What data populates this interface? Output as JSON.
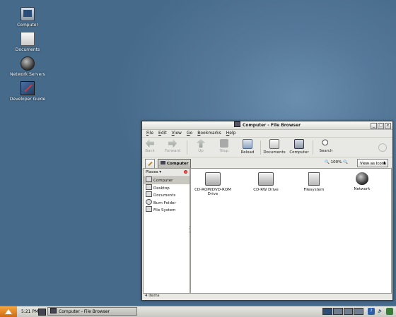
{
  "desktop": {
    "icons": [
      {
        "label": "Computer",
        "icon": "computer-icon"
      },
      {
        "label": "Documents",
        "icon": "documents-icon"
      },
      {
        "label": "Network Servers",
        "icon": "network-icon"
      },
      {
        "label": "Developer Guide",
        "icon": "guide-icon"
      }
    ]
  },
  "window": {
    "title": "Computer - File Browser",
    "menu": [
      "File",
      "Edit",
      "View",
      "Go",
      "Bookmarks",
      "Help"
    ],
    "toolbar": {
      "back": "Back",
      "forward": "Forward",
      "up": "Up",
      "stop": "Stop",
      "reload": "Reload",
      "documents": "Documents",
      "computer": "Computer",
      "search": "Search"
    },
    "location": {
      "path_button": "Computer",
      "zoom": "100%",
      "view_mode": "View as Icons"
    },
    "sidebar": {
      "header": "Places",
      "items": [
        "Computer",
        "Desktop",
        "Documents",
        "Burn Folder",
        "File System"
      ]
    },
    "items": [
      "CD-ROM/DVD-ROM Drive",
      "CD-RW Drive",
      "Filesystem",
      "Network"
    ],
    "status": "4 items"
  },
  "taskbar": {
    "clock": "5:21 PM",
    "task": "Computer - File Browser"
  },
  "colors": {
    "desktop": "#56799a",
    "start": "#e6861f"
  }
}
